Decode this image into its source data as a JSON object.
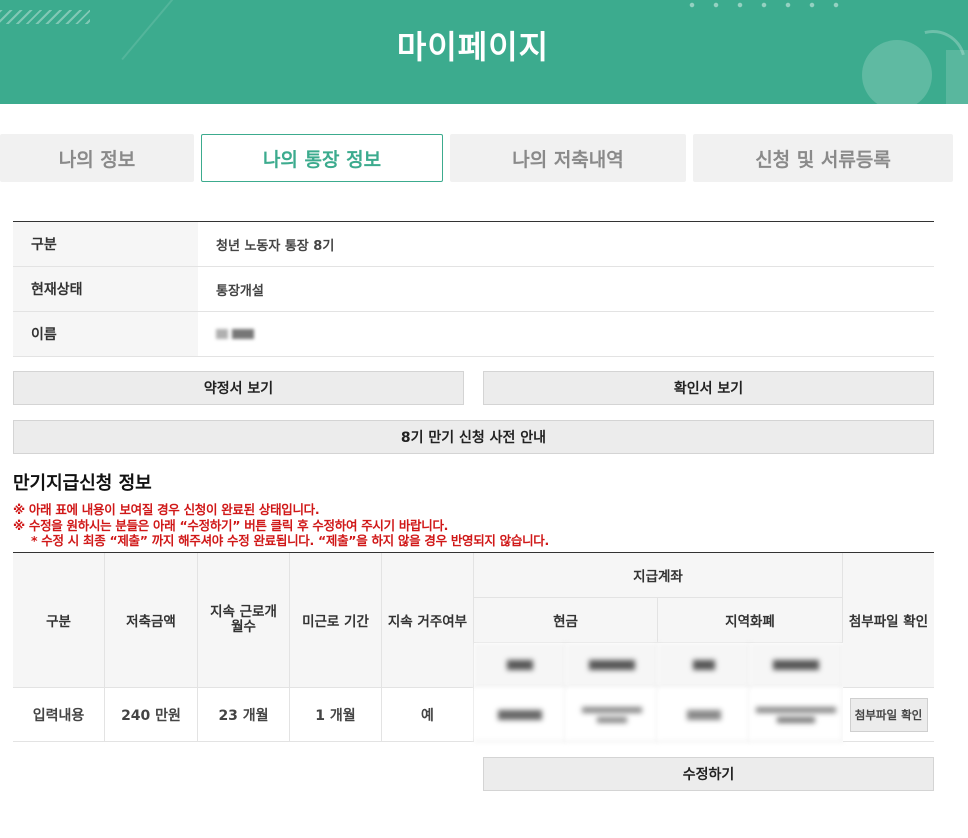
{
  "header": {
    "title": "마이페이지"
  },
  "tabs": [
    {
      "label": "나의 정보"
    },
    {
      "label": "나의 통장 정보"
    },
    {
      "label": "나의 저축내역"
    },
    {
      "label": "신청 및 서류등록"
    }
  ],
  "info": {
    "rows": [
      {
        "label": "구분",
        "value": "청년 노동자 통장 8기"
      },
      {
        "label": "현재상태",
        "value": "통장개설"
      },
      {
        "label": "이름",
        "value": ""
      }
    ]
  },
  "buttons": {
    "agreement": "약정서 보기",
    "confirmation": "확인서 보기",
    "notice": "8기 만기 신청 사전 안내",
    "edit": "수정하기"
  },
  "maturity": {
    "title": "만기지급신청 정보",
    "notices": [
      "※ 아래 표에 내용이 보여질 경우 신청이 완료된 상태입니다.",
      "※ 수정을 원하시는 분들은 아래 “수정하기” 버튼 클릭 후 수정하여 주시기 바랍니다.",
      "* 수정 시 최종 “제출” 까지 해주셔야 수정 완료됩니다. “제출”을 하지 않을 경우 반영되지 않습니다."
    ],
    "headers": {
      "category": "구분",
      "savings": "저축금액",
      "work_months": "지속 근로개월수",
      "non_work": "미근로 기간",
      "residence": "지속 거주여부",
      "account": "지급계좌",
      "cash": "현금",
      "local_currency": "지역화폐",
      "attachment": "첨부파일 확인"
    },
    "row": {
      "category": "입력내용",
      "savings": "240 만원",
      "work_months": "23 개월",
      "non_work": "1 개월",
      "residence": "예",
      "attach_button": "첨부파일 확인"
    }
  }
}
